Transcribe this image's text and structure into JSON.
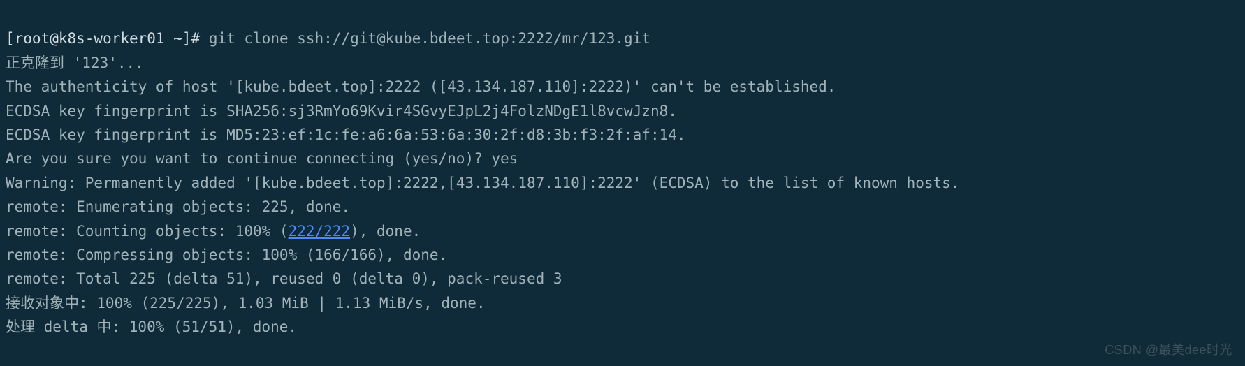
{
  "prompt": {
    "user_host": "[root@k8s-worker01 ~]#",
    "command": "git clone ssh://git@kube.bdeet.top:2222/mr/123.git"
  },
  "lines": {
    "cloning": "正克隆到 '123'...",
    "auth": "The authenticity of host '[kube.bdeet.top]:2222 ([43.134.187.110]:2222)' can't be established.",
    "sha256": "ECDSA key fingerprint is SHA256:sj3RmYo69Kvir4SGvyEJpL2j4FolzNDgE1l8vcwJzn8.",
    "md5": "ECDSA key fingerprint is MD5:23:ef:1c:fe:a6:6a:53:6a:30:2f:d8:3b:f3:2f:af:14.",
    "confirm": "Are you sure you want to continue connecting (yes/no)? yes",
    "warning": "Warning: Permanently added '[kube.bdeet.top]:2222,[43.134.187.110]:2222' (ECDSA) to the list of known hosts.",
    "enumerating": "remote: Enumerating objects: 225, done.",
    "counting_a": "remote: Counting objects: 100% (",
    "counting_link": "222/222",
    "counting_b": "), done.",
    "compressing": "remote: Compressing objects: 100% (166/166), done.",
    "total": "remote: Total 225 (delta 51), reused 0 (delta 0), pack-reused 3",
    "receiving": "接收对象中: 100% (225/225), 1.03 MiB | 1.13 MiB/s, done.",
    "deltas": "处理 delta 中: 100% (51/51), done."
  },
  "watermark": "CSDN @最美dee时光"
}
